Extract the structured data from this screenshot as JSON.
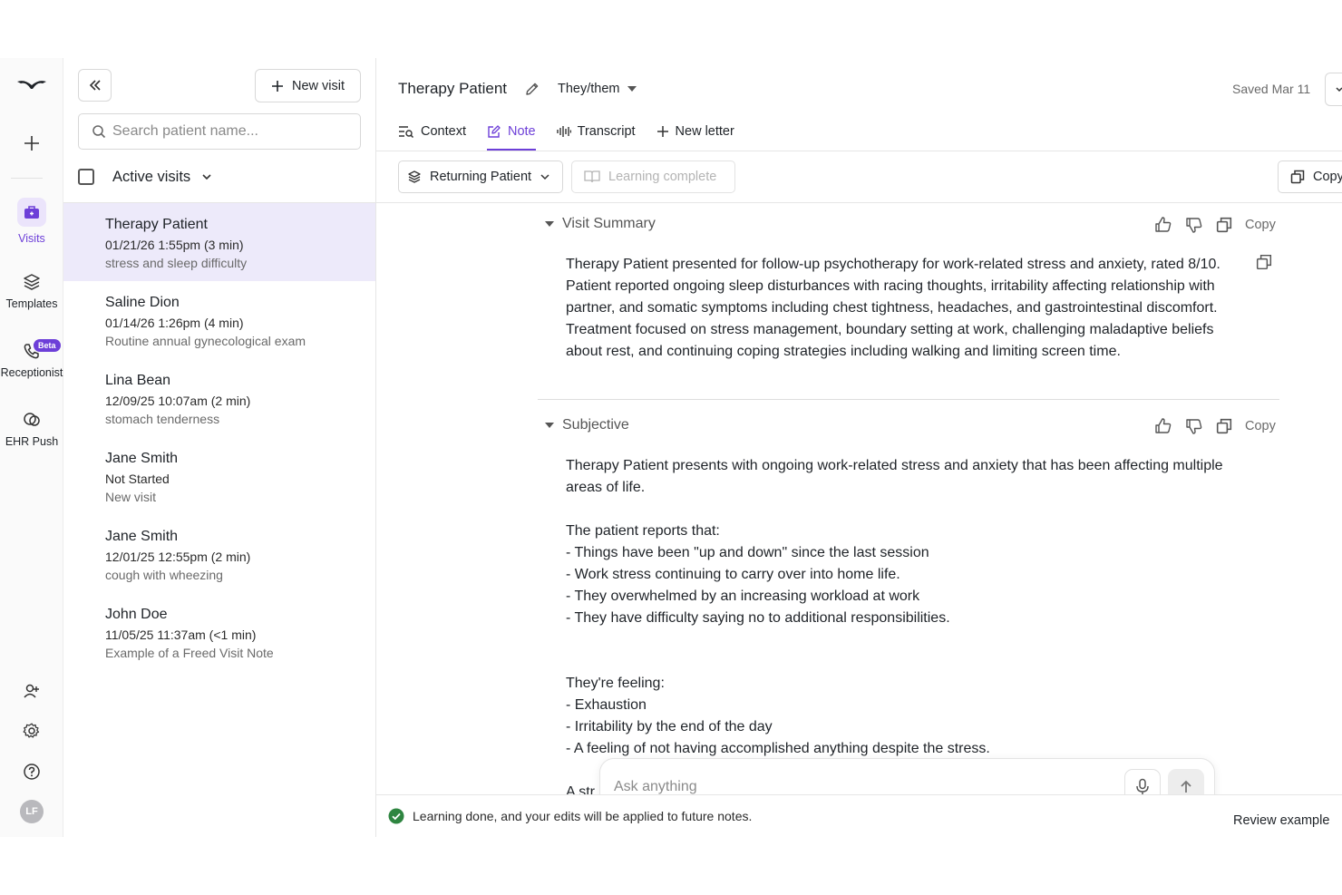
{
  "rail": {
    "items": [
      {
        "label": "Visits"
      },
      {
        "label": "Templates"
      },
      {
        "label": "Receptionist",
        "badge": "Beta"
      },
      {
        "label": "EHR Push"
      }
    ],
    "avatar_initials": "LF",
    "accent_color": "#6d3fd8"
  },
  "list": {
    "new_visit_label": "New visit",
    "search_placeholder": "Search patient name...",
    "filter_label": "Active visits",
    "visits": [
      {
        "name": "Therapy Patient",
        "date": "01/21/26 1:55pm (3 min)",
        "desc": "stress and sleep difficulty"
      },
      {
        "name": "Saline Dion",
        "date": "01/14/26 1:26pm (4 min)",
        "desc": "Routine annual gynecological exam"
      },
      {
        "name": "Lina Bean",
        "date": "12/09/25 10:07am (2 min)",
        "desc": "stomach tenderness"
      },
      {
        "name": "Jane Smith",
        "date": "Not Started",
        "desc": "New visit"
      },
      {
        "name": "Jane Smith",
        "date": "12/01/25 12:55pm (2 min)",
        "desc": "cough with wheezing"
      },
      {
        "name": "John Doe",
        "date": "11/05/25 11:37am (<1 min)",
        "desc": "Example of a Freed Visit Note"
      }
    ]
  },
  "header": {
    "title": "Therapy Patient",
    "pronouns": "They/them",
    "saved": "Saved Mar 11"
  },
  "tabs": [
    {
      "label": "Context"
    },
    {
      "label": "Note"
    },
    {
      "label": "Transcript"
    },
    {
      "label": "New letter"
    }
  ],
  "toolbar": {
    "template": "Returning Patient",
    "learning": "Learning complete",
    "copy": "Copy"
  },
  "sections": [
    {
      "title": "Visit Summary",
      "copy": "Copy",
      "body": "Therapy Patient presented for follow-up psychotherapy for work-related stress and anxiety, rated 8/10. Patient reported ongoing sleep disturbances with racing thoughts, irritability affecting relationship with partner, and somatic symptoms including chest tightness, headaches, and gastrointestinal discomfort. Treatment focused on stress management, boundary setting at work, challenging maladaptive beliefs about rest, and continuing coping strategies including walking and limiting screen time."
    },
    {
      "title": "Subjective",
      "copy": "Copy",
      "body": "Therapy Patient presents with ongoing work-related stress and anxiety that has been affecting multiple areas of life.\n\nThe patient reports that:\n-  Things have been \"up and down\" since the last session\n- Work stress continuing to carry over into home life.\n- They overwhelmed by an increasing workload at work\n- They have difficulty saying no to additional responsibilities.\n\n\nThey're feeling:\n- Exhaustion\n- Irritability by the end of the day\n- A feeling of not having accomplished anything despite the stress.\n\nA str"
    }
  ],
  "ask": {
    "placeholder": "Ask anything"
  },
  "status": {
    "message": "Learning done, and your edits will be applied to future notes.",
    "review": "Review example",
    "success_color": "#2e8540"
  }
}
